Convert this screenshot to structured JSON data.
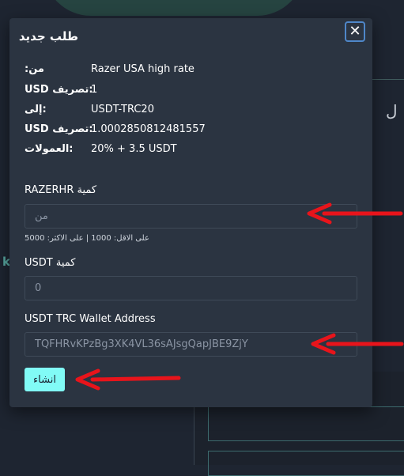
{
  "background": {
    "right_text": "ل",
    "left_text": "k"
  },
  "modal": {
    "title": "طلب جديد",
    "close_icon": "close-icon",
    "info": [
      {
        "label": ":من",
        "value": "Razer USA high rate"
      },
      {
        "label": "USD تصريف:",
        "value": "1"
      },
      {
        "label": "إلى:",
        "value": "USDT-TRC20"
      },
      {
        "label": "USD تصريف:",
        "value": "1.0002850812481557"
      },
      {
        "label": "العمولات:",
        "value": "20% + 3.5 USDT"
      }
    ],
    "amount_from_label": "RAZERHR كمية",
    "amount_from_placeholder": "من",
    "amount_from_hint": "على الاقل: 1000 | على الاكثر: 5000",
    "amount_to_label": "USDT كمية",
    "amount_to_placeholder": "0",
    "wallet_label": "USDT TRC Wallet Address",
    "wallet_value": "TQFHRvKPzBg3XK4VL36sAJsgQapJBE9ZjY",
    "submit_label": "انشاء"
  },
  "colors": {
    "accent": "#81fbf6",
    "arrow": "#e8141b",
    "modal_bg": "#2b3441"
  }
}
